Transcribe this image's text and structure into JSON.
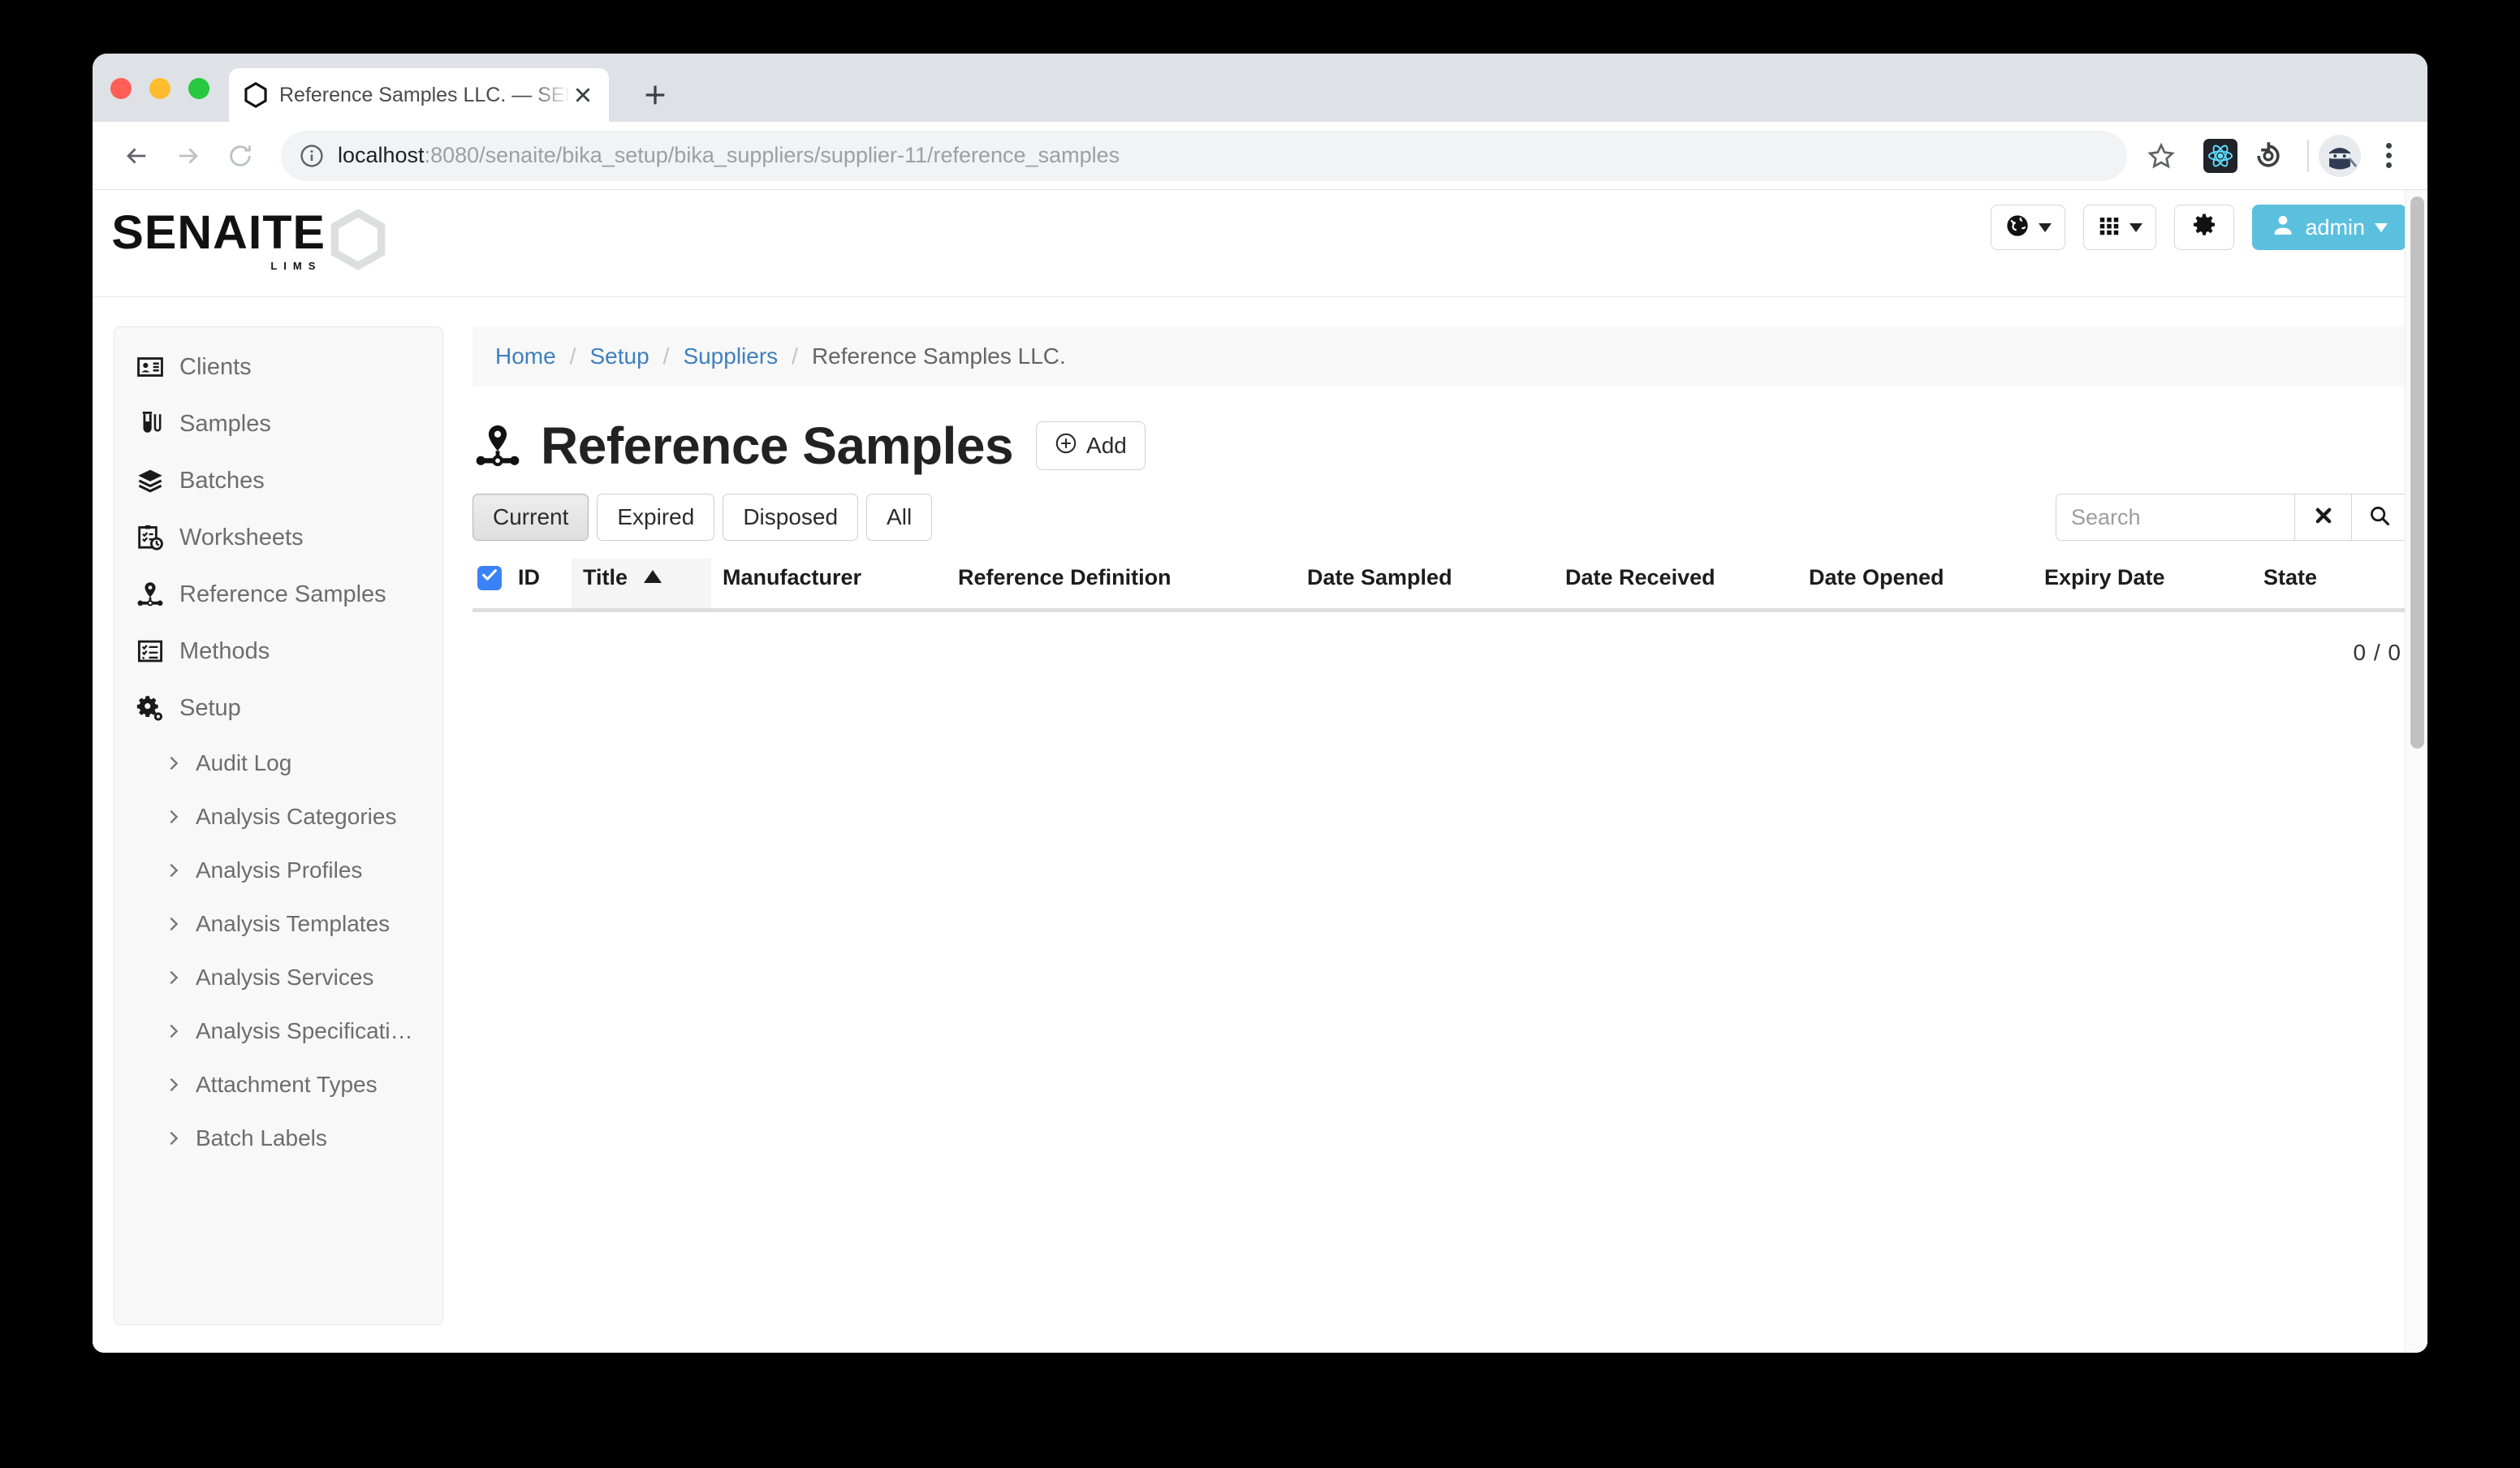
{
  "browser": {
    "tab": {
      "title": "Reference Samples LLC. — SENAITE LIMS",
      "favicon_icon": "hexagon-icon",
      "close_icon": "close-icon"
    },
    "new_tab_icon": "plus-icon",
    "nav": {
      "back_icon": "arrow-left-icon",
      "forward_icon": "arrow-right-icon",
      "reload_icon": "reload-icon"
    },
    "omnibox": {
      "site_info_icon": "info-circle-icon",
      "url_host": "localhost",
      "url_path": ":8080/senaite/bika_setup/bika_suppliers/supplier-11/reference_samples"
    },
    "bookmark_icon": "star-icon",
    "extensions": [
      {
        "name": "react-devtools-icon",
        "label": "React DevTools"
      },
      {
        "name": "history-reload-icon",
        "label": "Session Buddy"
      }
    ],
    "profile_avatar_icon": "ninja-avatar-icon",
    "menu_icon": "kebab-menu-icon"
  },
  "senaite": {
    "logo": {
      "wordmark": "SENAITE",
      "subtitle": "LIMS",
      "hexagon_icon": "hexagon-outline-icon"
    },
    "topbar_buttons": [
      {
        "name": "language-selector",
        "icon": "globe-icon",
        "label": ""
      },
      {
        "name": "apps-selector",
        "icon": "grid-icon",
        "label": ""
      },
      {
        "name": "settings",
        "icon": "gear-icon",
        "label": ""
      }
    ],
    "user_button": {
      "label": "admin",
      "icon": "user-icon",
      "color": "#5bc0de"
    }
  },
  "sidebar": {
    "items": [
      {
        "label": "Clients",
        "icon": "id-card-icon"
      },
      {
        "label": "Samples",
        "icon": "test-tube-icon"
      },
      {
        "label": "Batches",
        "icon": "layers-icon"
      },
      {
        "label": "Worksheets",
        "icon": "clipboard-clock-icon"
      },
      {
        "label": "Reference Samples",
        "icon": "reference-sample-icon"
      },
      {
        "label": "Methods",
        "icon": "checklist-icon"
      },
      {
        "label": "Setup",
        "icon": "gears-icon"
      }
    ],
    "sub_items": [
      {
        "label": "Audit Log",
        "icon": "chevron-right-icon"
      },
      {
        "label": "Analysis Categories",
        "icon": "chevron-right-icon"
      },
      {
        "label": "Analysis Profiles",
        "icon": "chevron-right-icon"
      },
      {
        "label": "Analysis Templates",
        "icon": "chevron-right-icon"
      },
      {
        "label": "Analysis Services",
        "icon": "chevron-right-icon"
      },
      {
        "label": "Analysis Specificati…",
        "icon": "chevron-right-icon"
      },
      {
        "label": "Attachment Types",
        "icon": "chevron-right-icon"
      },
      {
        "label": "Batch Labels",
        "icon": "chevron-right-icon"
      }
    ]
  },
  "breadcrumb": {
    "items": [
      {
        "label": "Home",
        "link": true
      },
      {
        "label": "Setup",
        "link": true
      },
      {
        "label": "Suppliers",
        "link": true
      },
      {
        "label": "Reference Samples LLC.",
        "link": false
      }
    ],
    "separator": "/"
  },
  "page": {
    "title": "Reference Samples",
    "title_icon": "reference-sample-icon",
    "add_button": {
      "label": "Add",
      "icon": "plus-circle-icon"
    }
  },
  "filters": {
    "tabs": [
      {
        "label": "Current",
        "active": true
      },
      {
        "label": "Expired",
        "active": false
      },
      {
        "label": "Disposed",
        "active": false
      },
      {
        "label": "All",
        "active": false
      }
    ]
  },
  "search": {
    "value": "",
    "placeholder": "Search",
    "clear_icon": "times-icon",
    "submit_icon": "magnifier-icon"
  },
  "table": {
    "select_all_checked": true,
    "select_all_icon": "checkmark-icon",
    "sort_column": "Title",
    "sort_direction": "asc",
    "sort_icon": "triangle-up-icon",
    "columns": [
      "ID",
      "Title",
      "Manufacturer",
      "Reference Definition",
      "Date Sampled",
      "Date Received",
      "Date Opened",
      "Expiry Date",
      "State"
    ],
    "rows": [],
    "count_label": "0 / 0"
  },
  "colors": {
    "accent": "#5bc0de",
    "link": "#3f7fc1",
    "checkbox": "#3b82f6",
    "page_bg": "#ffffff",
    "panel_bg": "#f8f8f8"
  }
}
